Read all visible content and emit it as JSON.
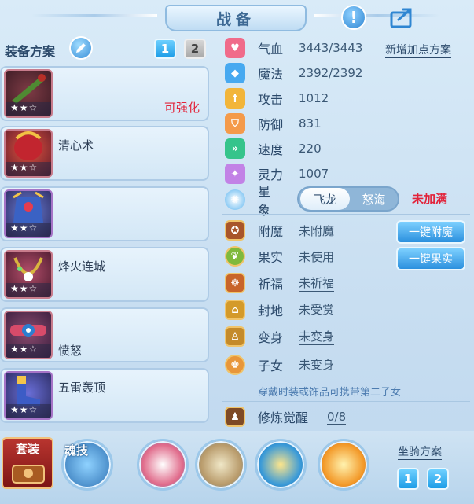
{
  "header": {
    "title": "战备",
    "info_icon": "info-icon",
    "share_icon": "share-icon"
  },
  "equipment": {
    "plan_label": "装备方案",
    "plan_tabs": [
      "1",
      "2"
    ],
    "stars": "★★☆",
    "items": [
      {
        "name": "",
        "tag": "可强化"
      },
      {
        "name": "清心术",
        "tag": ""
      },
      {
        "name": "",
        "tag": ""
      },
      {
        "name": "烽火连城",
        "tag": ""
      },
      {
        "name": "愤怒",
        "tag": ""
      },
      {
        "name": "五雷轰顶",
        "tag": ""
      }
    ]
  },
  "stats": {
    "add_plan_link": "新增加点方案",
    "rows": [
      {
        "label": "气血",
        "value": "3443/3443",
        "icon": "heart-icon",
        "color": "#f06b8a"
      },
      {
        "label": "魔法",
        "value": "2392/2392",
        "icon": "magic-icon",
        "color": "#47a9f0"
      },
      {
        "label": "攻击",
        "value": "1012",
        "icon": "sword-icon",
        "color": "#f2b53a"
      },
      {
        "label": "防御",
        "value": "831",
        "icon": "shield-icon",
        "color": "#f49a4a"
      },
      {
        "label": "速度",
        "value": "220",
        "icon": "speed-icon",
        "color": "#35c48b"
      },
      {
        "label": "灵力",
        "value": "1007",
        "icon": "spirit-icon",
        "color": "#c282e6"
      }
    ],
    "star": {
      "label": "星象",
      "options": [
        "飞龙",
        "怒海"
      ],
      "status": "未加满"
    }
  },
  "features": {
    "rows": [
      {
        "label": "附魔",
        "value": "未附魔"
      },
      {
        "label": "果实",
        "value": "未使用"
      },
      {
        "label": "祈福",
        "value": "未祈福"
      },
      {
        "label": "封地",
        "value": "未受赏"
      },
      {
        "label": "变身",
        "value": "未变身"
      },
      {
        "label": "子女",
        "value": "未变身"
      }
    ],
    "enchant_button": "一键附魔",
    "fruit_button": "一键果实",
    "hint": "穿戴时装或饰品可携带第二子女",
    "cultivation": {
      "label": "修炼觉醒",
      "value": "0/8"
    }
  },
  "bottom": {
    "outfit_label": "套装",
    "soul_skill_label": "魂技",
    "mount_label": "坐骑方案",
    "mount_tabs": [
      "1",
      "2"
    ]
  }
}
